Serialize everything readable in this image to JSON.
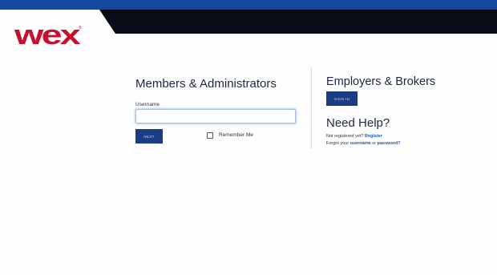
{
  "brand": {
    "logo_text": "wex",
    "primary_color": "#14479d",
    "dark_band_color": "#070b16",
    "logo_color": "#c8102e",
    "button_color": "#1a3e86",
    "link_color": "#1a5bb8"
  },
  "members": {
    "title": "Members & Administrators",
    "username_label": "Username",
    "username_value": "",
    "next_label": "NEXT",
    "remember_label": "Remember Me",
    "remember_checked": false
  },
  "employers": {
    "title": "Employers & Brokers",
    "signin_label": "SIGN IN"
  },
  "help": {
    "title": "Need Help?",
    "not_registered_text": "Not registered yet?",
    "register_link": "Register",
    "forgot_text": "Forgot your",
    "username_link": "username",
    "or_text": "or",
    "password_link": "password?"
  }
}
